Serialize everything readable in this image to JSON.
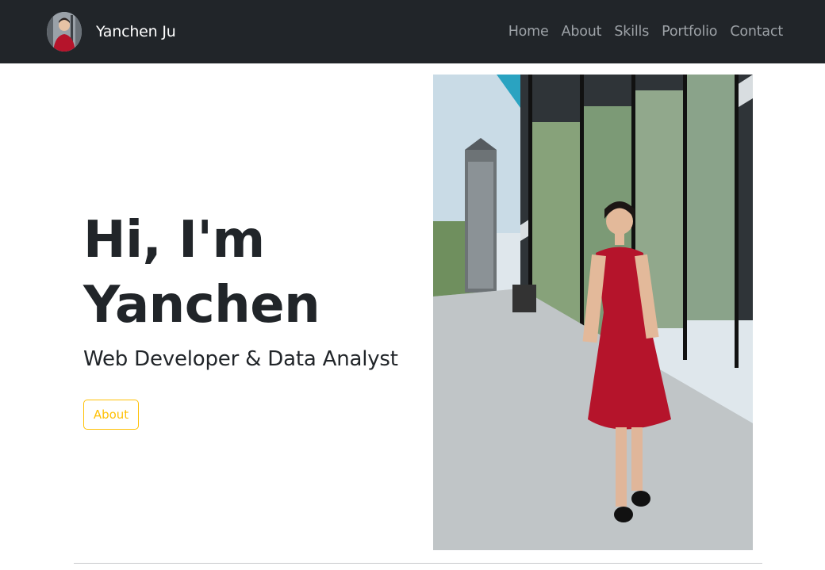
{
  "navbar": {
    "brand_name": "Yanchen Ju",
    "avatar_icon": "profile-photo",
    "links": [
      {
        "label": "Home"
      },
      {
        "label": "About"
      },
      {
        "label": "Skills"
      },
      {
        "label": "Portfolio"
      },
      {
        "label": "Contact"
      }
    ]
  },
  "hero": {
    "title_line1": "Hi, I'm",
    "title_line2": "Yanchen",
    "subtitle": "Web Developer & Data Analyst",
    "button_label": "About",
    "photo_alt": "Portrait photo"
  },
  "colors": {
    "navbar_bg": "#212529",
    "nav_link": "#9da2a7",
    "accent": "#ffc107",
    "text": "#212529"
  }
}
